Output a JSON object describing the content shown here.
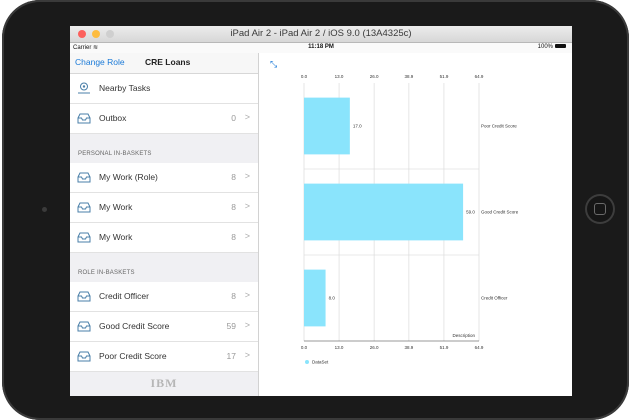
{
  "window": {
    "title": "iPad Air 2 - iPad Air 2 / iOS 9.0 (13A4325c)"
  },
  "statusbar": {
    "carrier": "Carrier",
    "time": "11:18 PM",
    "battery": "100%"
  },
  "nav": {
    "back_label": "Change Role",
    "title": "CRE Loans"
  },
  "sidebar": {
    "items_top": [
      {
        "label": "Nearby Tasks",
        "icon": "location-pin-icon"
      },
      {
        "label": "Outbox",
        "count": "0",
        "icon": "inbox-tray-icon"
      }
    ],
    "personal_header": "PERSONAL IN-BASKETS",
    "personal": [
      {
        "label": "My Work (Role)",
        "count": "8"
      },
      {
        "label": "My Work",
        "count": "8"
      },
      {
        "label": "My Work",
        "count": "8"
      }
    ],
    "role_header": "ROLE IN-BASKETS",
    "role": [
      {
        "label": "Credit Officer",
        "count": "8"
      },
      {
        "label": "Good Credit Score",
        "count": "59"
      },
      {
        "label": "Poor Credit Score",
        "count": "17"
      }
    ],
    "logo": "IBM"
  },
  "chart_data": {
    "type": "bar",
    "orientation": "horizontal",
    "categories": [
      "Poor Credit Score",
      "Good Credit Score",
      "Credit Officer"
    ],
    "values": [
      17.0,
      59.0,
      8.0
    ],
    "value_labels": [
      "17.0",
      "59.0",
      "8.0"
    ],
    "ticks": [
      "0.0",
      "13.0",
      "26.0",
      "38.9",
      "51.9",
      "64.9"
    ],
    "xlim": [
      0,
      64.9
    ],
    "axis_label": "Description",
    "legend": "DataSet",
    "legend_position": "bottom-left",
    "bar_color": "#8ae4fc",
    "grid": true
  },
  "colors": {
    "accent": "#1a7ad8"
  }
}
